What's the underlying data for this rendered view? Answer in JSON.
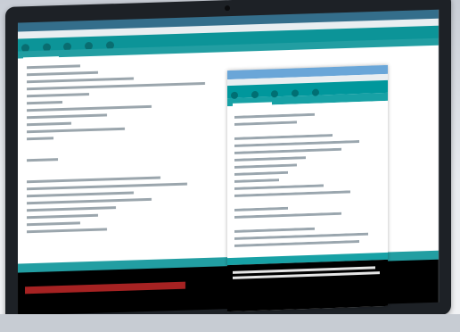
{
  "scene": {
    "description": ""
  },
  "ide": {
    "menu_text": "",
    "console_text": ""
  },
  "overlay_window": {
    "title": "",
    "tab_label": ""
  },
  "colors": {
    "toolbar": "#00979c",
    "tab_strip": "#17a1a5",
    "console": "#000000",
    "error": "#b11f1f",
    "titlebar": "#2f6f8f"
  }
}
